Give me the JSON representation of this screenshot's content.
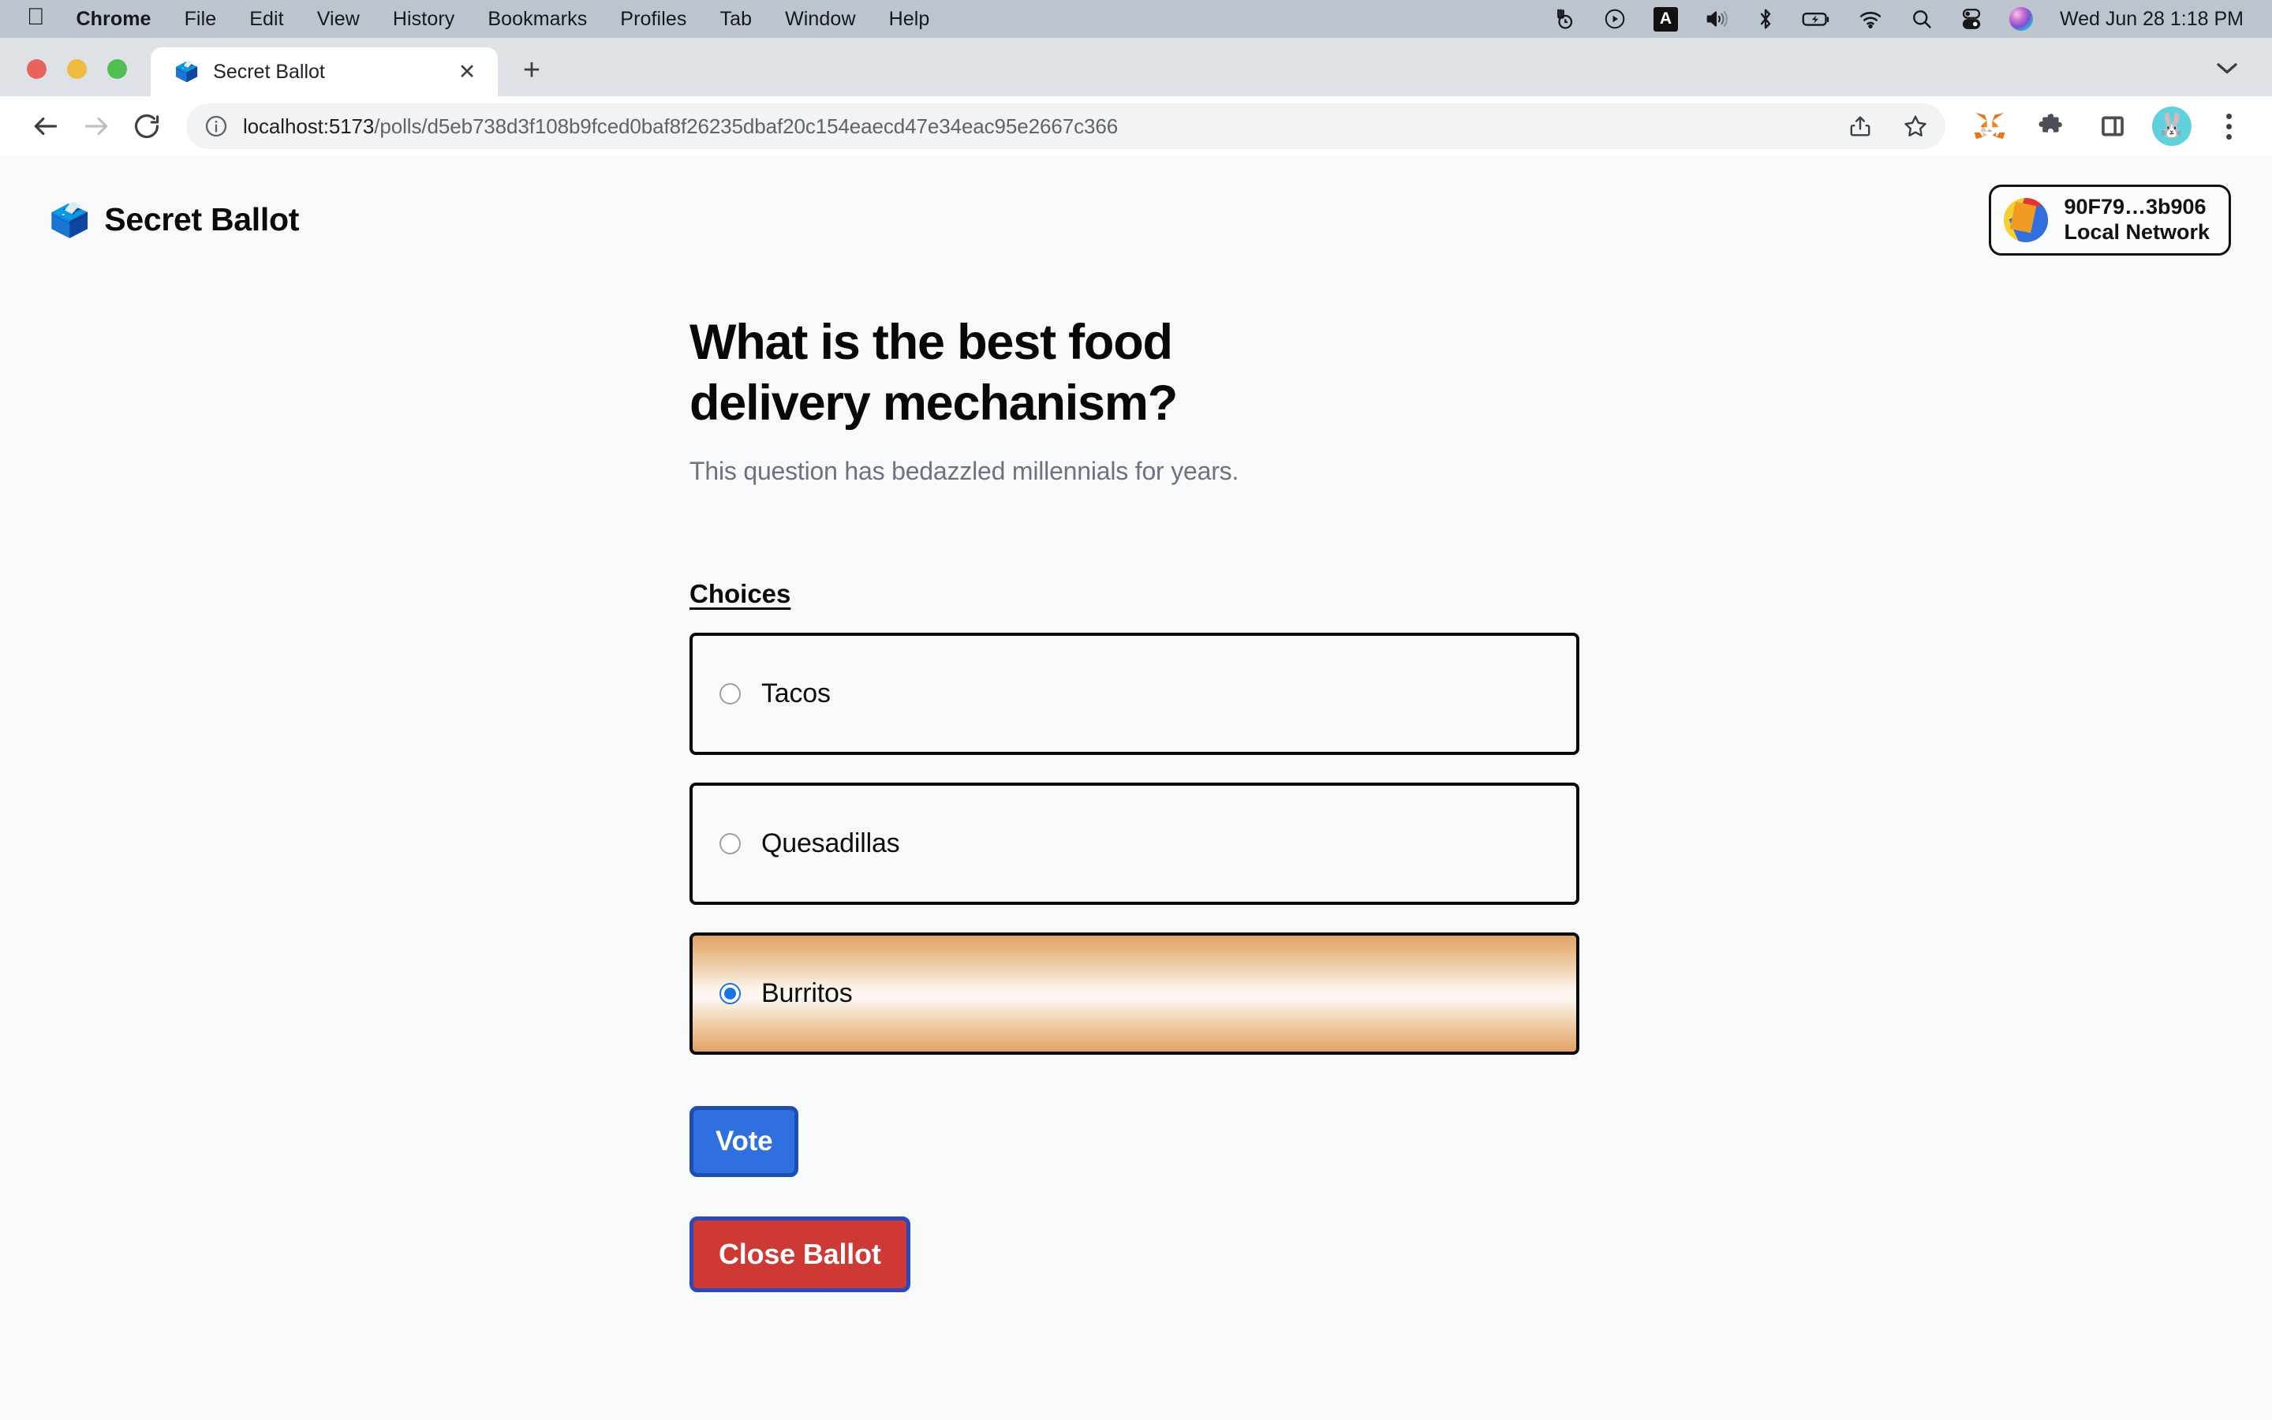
{
  "menubar": {
    "apple_icon": "apple-logo",
    "items": [
      "Chrome",
      "File",
      "Edit",
      "View",
      "History",
      "Bookmarks",
      "Profiles",
      "Tab",
      "Window",
      "Help"
    ],
    "status_icons": [
      "time-machine-icon",
      "play-circle-icon",
      "keyboard-input-a-icon",
      "volume-icon",
      "bluetooth-icon",
      "battery-charging-icon",
      "wifi-icon",
      "spotlight-search-icon",
      "control-center-icon",
      "siri-icon"
    ],
    "keyboard_badge": "A",
    "clock": "Wed Jun 28  1:18 PM"
  },
  "browser": {
    "window_controls": [
      "close-button",
      "minimize-button",
      "maximize-button"
    ],
    "tab": {
      "favicon": "🗳️",
      "title": "Secret Ballot",
      "close_label": "✕"
    },
    "new_tab_label": "+",
    "tab_list_icon": "chevron-down-icon",
    "nav": {
      "back_icon": "back-arrow-icon",
      "forward_icon": "forward-arrow-icon",
      "reload_icon": "reload-icon"
    },
    "omnibox": {
      "site_info_icon": "info-circle-icon",
      "host": "localhost:5173",
      "path": "/polls/d5eb738d3f108b9fced0baf8f26235dbaf20c154eaecd47e34eac95e2667c366",
      "full_url": "localhost:5173/polls/d5eb738d3f108b9fced0baf8f26235dbaf20c154eaecd47e34eac95e2667c366",
      "share_icon": "share-icon",
      "bookmark_icon": "star-icon"
    },
    "extensions": [
      "metamask-fox-icon",
      "puzzle-extensions-icon",
      "side-panel-icon"
    ],
    "profile_avatar": "🐰",
    "menu_icon": "three-dot-menu-icon"
  },
  "app": {
    "brand": {
      "logo": "🗳️",
      "name": "Secret Ballot"
    },
    "wallet": {
      "address": "90F79…3b906",
      "network": "Local Network",
      "avatar": "blockies-avatar"
    }
  },
  "poll": {
    "title": "What is the best food delivery mechanism?",
    "description": "This question has bedazzled millennials for years.",
    "choices_label": "Choices",
    "choices": [
      {
        "label": "Tacos",
        "selected": false
      },
      {
        "label": "Quesadillas",
        "selected": false
      },
      {
        "label": "Burritos",
        "selected": true
      }
    ],
    "vote_button": "Vote",
    "close_button": "Close Ballot"
  },
  "colors": {
    "accent_blue": "#2f6fe0",
    "danger_red": "#ce3a33",
    "selected_orange": "#dfa365",
    "page_bg": "#f8f9fa",
    "menubar_bg": "#bcc4ce"
  }
}
